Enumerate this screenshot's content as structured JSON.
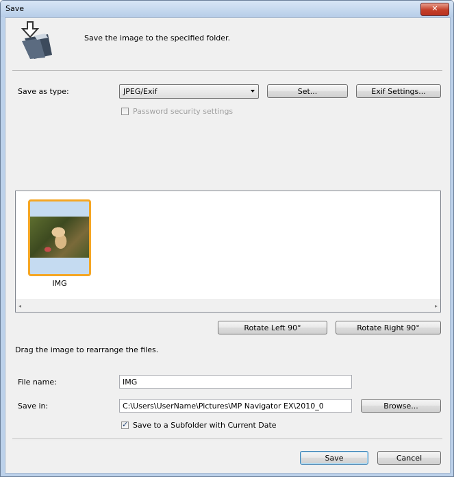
{
  "window": {
    "title": "Save",
    "close_symbol": "✕"
  },
  "header": {
    "description": "Save the image to the specified folder."
  },
  "save_as_type": {
    "label": "Save as type:",
    "value": "JPEG/Exif"
  },
  "buttons": {
    "set": "Set...",
    "exif_settings": "Exif Settings...",
    "rotate_left": "Rotate Left 90°",
    "rotate_right": "Rotate Right 90°",
    "browse": "Browse...",
    "save": "Save",
    "cancel": "Cancel"
  },
  "password_security": {
    "label": "Password security settings",
    "checked": false,
    "enabled": false
  },
  "thumbnails": [
    {
      "label": "IMG",
      "selected": true
    }
  ],
  "hint": "Drag the image to rearrange the files.",
  "file_name": {
    "label": "File name:",
    "value": "IMG"
  },
  "save_in": {
    "label": "Save in:",
    "value": "C:\\Users\\UserName\\Pictures\\MP Navigator EX\\2010_0"
  },
  "subfolder": {
    "label": "Save to a Subfolder with Current Date",
    "checked": true
  },
  "icons": {
    "scroll_left": "◂",
    "scroll_right": "▸",
    "folder_save": "folder-save-icon"
  }
}
